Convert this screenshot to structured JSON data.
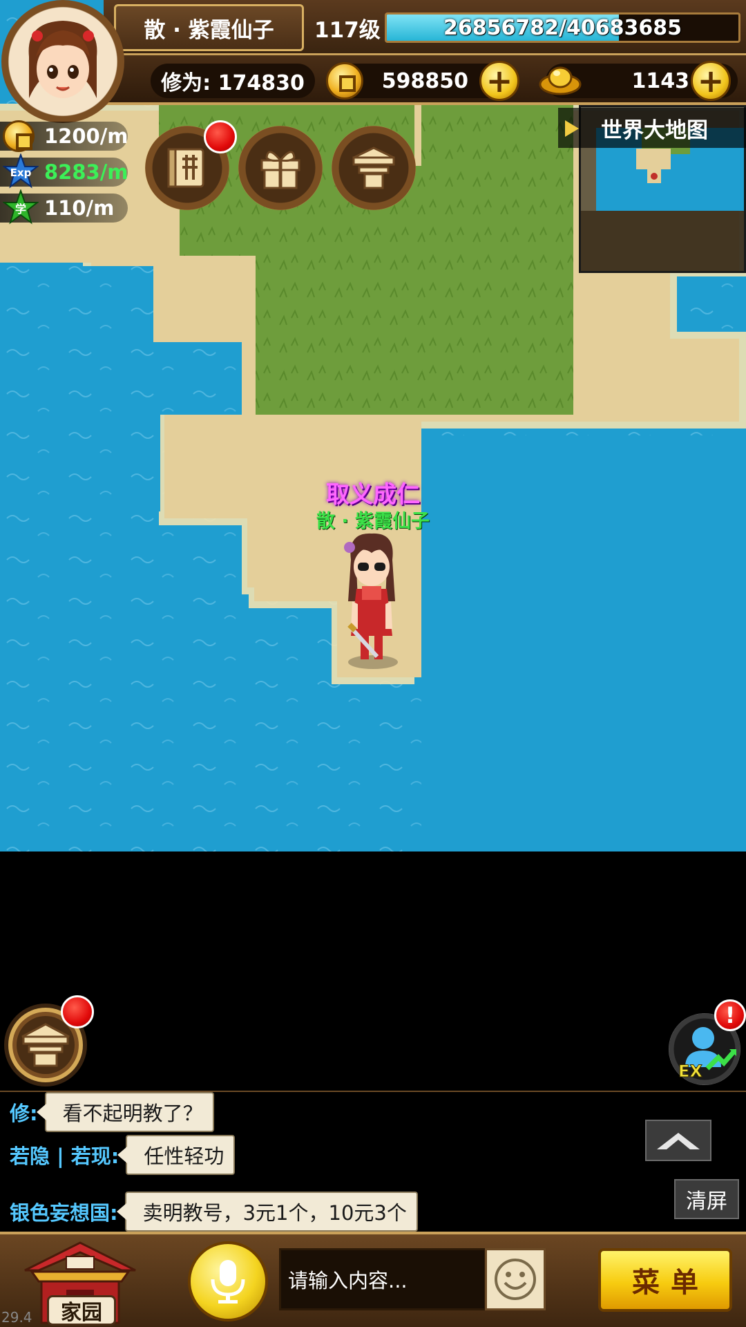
{
  "player": {
    "name": "散 · 紫霞仙子",
    "level": "117级",
    "exp_text": "26856782/40683685",
    "exp_fraction": 0.66,
    "cultivation": "修为: 174830",
    "title": "取义成仁",
    "map_name": "散 · 紫霞仙子"
  },
  "currency": {
    "copper": "598850",
    "gold": "1143"
  },
  "rates": {
    "coin": "1200/m",
    "exp_icon": "Exp",
    "exp": "8283/m",
    "study_icon": "学",
    "study": "110/m"
  },
  "icons": {
    "quick_buttons": [
      "book-icon",
      "gift-icon",
      "shop-icon"
    ],
    "currency": [
      "copper-coin-icon",
      "gold-ingot-icon"
    ]
  },
  "minimap": {
    "title": "世界大地图"
  },
  "ex_button": {
    "label": "EX",
    "alert": "!"
  },
  "chat": {
    "messages": [
      {
        "sender": "修:",
        "text": "看不起明教了？"
      },
      {
        "sender": "若隐 | 若现:",
        "text": "任性轻功"
      },
      {
        "sender": "银色妄想国:",
        "text": "卖明教号，3元1个，10元3个"
      }
    ],
    "clear_label": "清屏"
  },
  "bottom": {
    "home_label": "家园",
    "input_placeholder": "请输入内容...",
    "menu_label": "菜单"
  },
  "fps": "29.4",
  "colors": {
    "sea": "#1f9ed0",
    "sand": "#e4cf9a",
    "grass": "#6b9a3a",
    "hud_brown": "#4a2e16",
    "gold_border": "#caa15a",
    "chat_sender": "#55c8ff",
    "title_purple": "#ff66ff",
    "name_green": "#3ce048"
  }
}
